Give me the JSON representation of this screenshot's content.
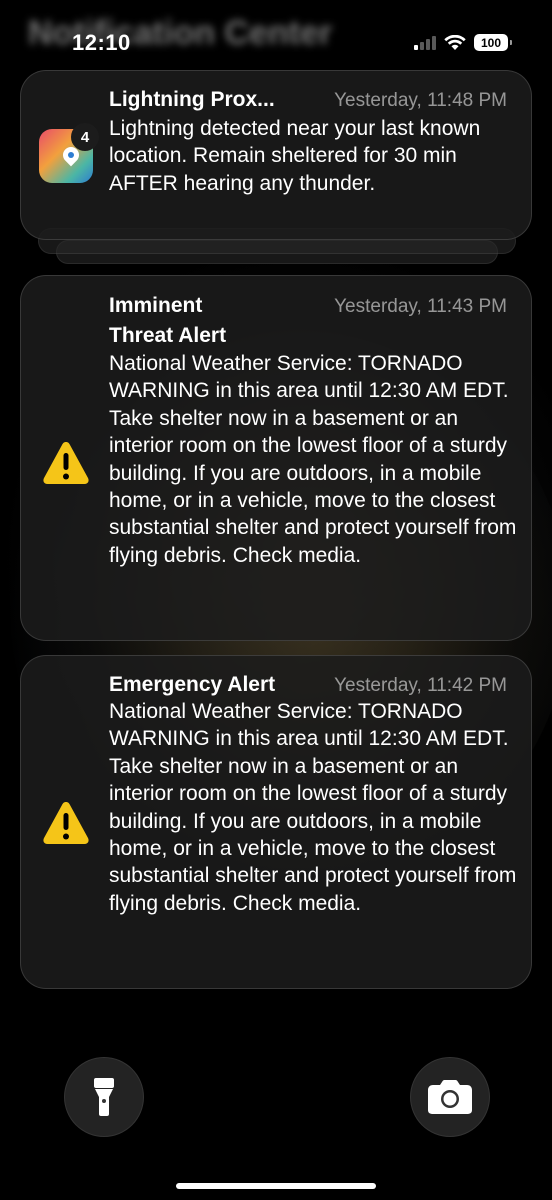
{
  "status_bar": {
    "time": "12:10",
    "battery": "100",
    "background_title": "Notification Center"
  },
  "notifications": [
    {
      "app": "Lightning Prox...",
      "timestamp": "Yesterday, 11:48 PM",
      "body": "Lightning detected near your last known location. Remain sheltered for 30 min AFTER hearing any thunder.",
      "badge": "4",
      "icon": "lightning-app-icon"
    },
    {
      "title_line1": "Imminent",
      "title_line2": "Threat Alert",
      "timestamp": "Yesterday, 11:43 PM",
      "body": "National Weather Service: TORNADO WARNING in this area until 12:30 AM EDT. Take shelter now in a basement or an interior room on the lowest floor of a sturdy building. If you are outdoors, in a mobile home, or in a vehicle, move to the closest substantial shelter and protect yourself from flying debris. Check media.",
      "icon": "warning-icon"
    },
    {
      "title": "Emergency Alert",
      "timestamp": "Yesterday, 11:42 PM",
      "body": "National Weather Service: TORNADO WARNING in this area until 12:30 AM EDT. Take shelter now in a basement or an interior room on the lowest floor of a sturdy building. If you are outdoors, in a mobile home, or in a vehicle, move to the closest substantial shelter and protect yourself from flying debris. Check media.",
      "icon": "warning-icon"
    }
  ],
  "bottom_controls": {
    "flashlight_icon": "flashlight-icon",
    "camera_icon": "camera-icon"
  },
  "colors": {
    "warning_yellow": "#F5C518",
    "card_background": "#1C1C1C"
  }
}
